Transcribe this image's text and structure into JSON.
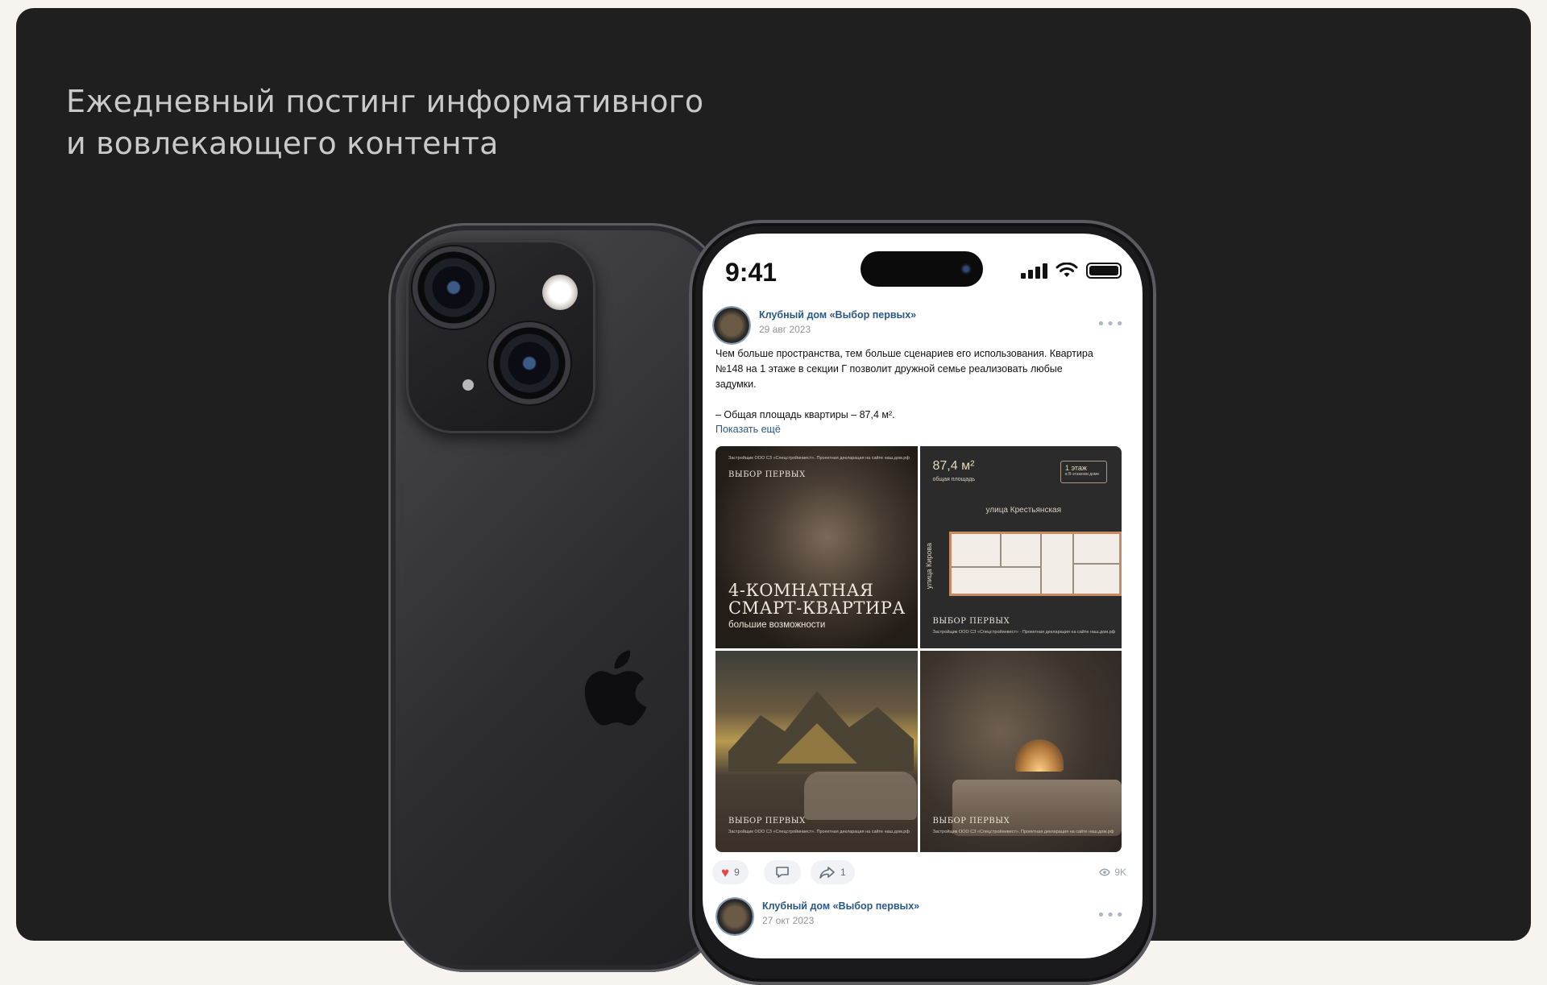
{
  "headline": {
    "line1": "Ежедневный постинг информативного",
    "line2": "и вовлекающего контента"
  },
  "status_bar": {
    "time": "9:41"
  },
  "post": {
    "author": "Клубный дом «Выбор первых»",
    "date": "29 авг 2023",
    "text_line1": "Чем больше пространства, тем больше сценариев его использования. Квартира",
    "text_line2": "№148 на 1 этаже в секции Г позволит дружной семье реализовать любые",
    "text_line3": "задумки.",
    "text_line4": "– Общая площадь квартиры – 87,4 м².",
    "show_more": "Показать ещё",
    "images": {
      "t1": {
        "brand": "ВЫБОР ПЕРВЫХ",
        "legal": "Застройщик ООО СЗ «Спецстройинвест». Проектная декларация на сайте наш.дом.рф",
        "title1": "4-КОМНАТНАЯ",
        "title2": "СМАРТ-КВАРТИРА",
        "subtitle": "большие возможности"
      },
      "t2": {
        "area": "87,4 м²",
        "area_label": "общая площадь",
        "floor": "1 этаж",
        "floor_sub": "в В-этажном доме",
        "street_top": "улица Крестьянская",
        "street_side": "улица Кирова",
        "brand": "ВЫБОР ПЕРВЫХ",
        "legal": "Застройщик ООО СЗ «Спецстройинвест» · Проектная декларация на сайте наш.дом.рф"
      },
      "t3": {
        "brand": "ВЫБОР ПЕРВЫХ",
        "legal": "Застройщик ООО СЗ «Спецстройинвест». Проектная декларация на сайте наш.дом.рф"
      },
      "t4": {
        "brand": "ВЫБОР ПЕРВЫХ",
        "legal": "Застройщик ООО СЗ «Спецстройинвест». Проектная декларация на сайте наш.дом.рф"
      }
    },
    "likes": "9",
    "shares": "1",
    "views": "9K"
  },
  "post2": {
    "author": "Клубный дом «Выбор первых»",
    "date": "27 окт 2023"
  },
  "icons": {
    "more": "more-icon",
    "heart": "heart-icon",
    "comment": "comment-icon",
    "share": "share-icon",
    "views": "eye-icon"
  },
  "colors": {
    "card_bg": "#1f1f1f",
    "link": "#2a5885",
    "like": "#e64646"
  }
}
